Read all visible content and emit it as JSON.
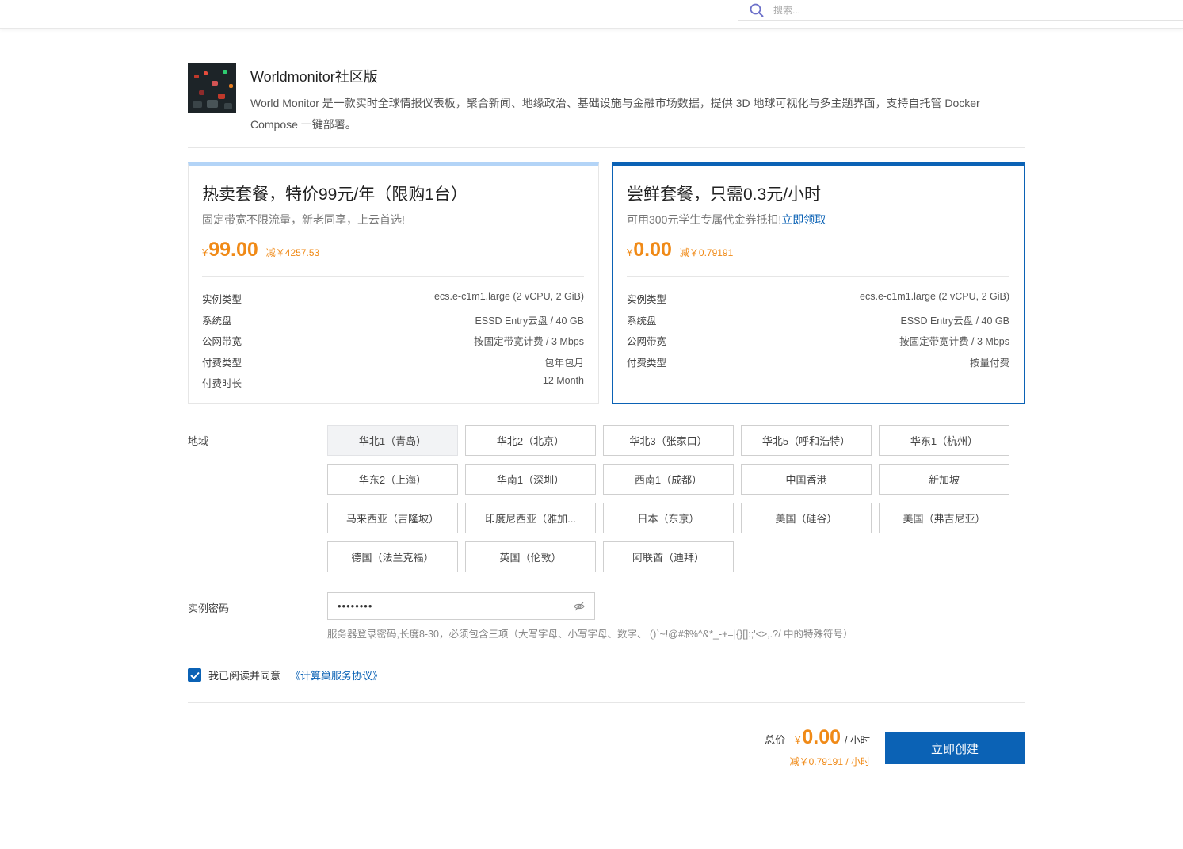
{
  "search": {
    "placeholder": "搜索..."
  },
  "product": {
    "title": "Worldmonitor社区版",
    "description": "World Monitor 是一款实时全球情报仪表板，聚合新闻、地缘政治、基础设施与金融市场数据，提供 3D 地球可视化与多主题界面，支持自托管 Docker Compose 一键部署。"
  },
  "plans": [
    {
      "title": "热卖套餐，特价99元/年（限购1台）",
      "subtitle": "固定带宽不限流量，新老同享，上云首选!",
      "currency": "¥",
      "price": "99.00",
      "discount": "减￥4257.53",
      "specs": [
        {
          "label": "实例类型",
          "value": "ecs.e-c1m1.large (2 vCPU, 2 GiB)"
        },
        {
          "label": "系统盘",
          "value": "ESSD Entry云盘 / 40 GB"
        },
        {
          "label": "公网带宽",
          "value": "按固定带宽计费 / 3 Mbps"
        },
        {
          "label": "付费类型",
          "value": "包年包月"
        },
        {
          "label": "付费时长",
          "value": "12 Month"
        }
      ]
    },
    {
      "title": "尝鲜套餐，只需0.3元/小时",
      "subtitle": "可用300元学生专属代金券抵扣!",
      "link": "立即领取",
      "currency": "¥",
      "price": "0.00",
      "discount": "减￥0.79191",
      "specs": [
        {
          "label": "实例类型",
          "value": "ecs.e-c1m1.large (2 vCPU, 2 GiB)"
        },
        {
          "label": "系统盘",
          "value": "ESSD Entry云盘 / 40 GB"
        },
        {
          "label": "公网带宽",
          "value": "按固定带宽计费 / 3 Mbps"
        },
        {
          "label": "付费类型",
          "value": "按量付费"
        }
      ]
    }
  ],
  "region": {
    "label": "地域",
    "options": [
      "华北1（青岛）",
      "华北2（北京）",
      "华北3（张家口）",
      "华北5（呼和浩特）",
      "华东1（杭州）",
      "华东2（上海）",
      "华南1（深圳）",
      "西南1（成都）",
      "中国香港",
      "新加坡",
      "马来西亚（吉隆坡）",
      "印度尼西亚（雅加...",
      "日本（东京）",
      "美国（硅谷）",
      "美国（弗吉尼亚）",
      "德国（法兰克福）",
      "英国（伦敦）",
      "阿联酋（迪拜）"
    ],
    "selected": "华北1（青岛）"
  },
  "password": {
    "label": "实例密码",
    "value": "********",
    "hint": "服务器登录密码,长度8-30，必须包含三项（大写字母、小写字母、数字、 ()`~!@#$%^&*_-+=|{}[]:;'<>,.?/ 中的特殊符号）"
  },
  "agreement": {
    "checked": true,
    "text": "我已阅读并同意",
    "link": "《计算巢服务协议》"
  },
  "total": {
    "label": "总价",
    "currency": "¥",
    "price": "0.00",
    "unit": "/ 小时",
    "discount": "减￥0.79191 / 小时"
  },
  "create_button": "立即创建",
  "colors": {
    "accent": "#0b62b5",
    "price": "#f08a17"
  }
}
